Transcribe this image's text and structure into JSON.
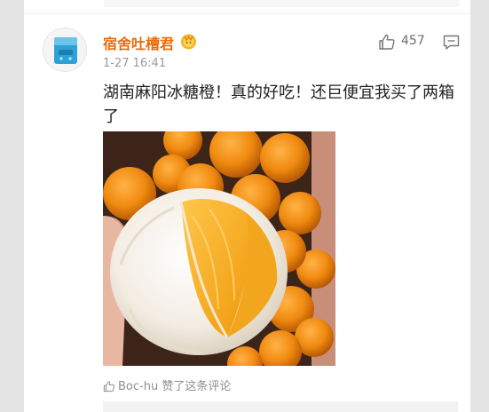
{
  "comment": {
    "username": "宿舍吐槽君",
    "timestamp": "1-27 16:41",
    "like_count": "457",
    "text": "湖南麻阳冰糖橙！真的好吃！还巨便宜我买了两箱了",
    "liked_by": "Boc-hu",
    "liked_suffix": " 赞了这条评论"
  },
  "icons": {
    "avatar": "blue-box-avatar",
    "badge": "gold-fan-badge-icon",
    "like": "thumbs-up-icon",
    "comment": "comment-bubble-icon"
  },
  "colors": {
    "username": "#e86b0c",
    "text": "#222222",
    "meta": "#9a9a9a"
  }
}
